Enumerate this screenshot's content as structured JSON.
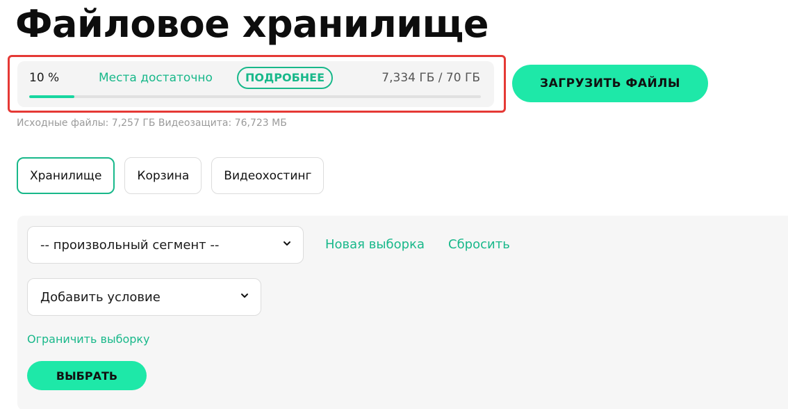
{
  "page": {
    "title": "Файловое хранилище"
  },
  "storage": {
    "percent_label": "10 %",
    "percent_value": 10,
    "status": "Места достаточно",
    "more_label": "ПОДРОБНЕЕ",
    "usage": "7,334 ГБ / 70 ГБ",
    "details": "Исходные файлы: 7,257 ГБ Видеозащита: 76,723 МБ"
  },
  "actions": {
    "upload_label": "ЗАГРУЗИТЬ ФАЙЛЫ"
  },
  "tabs": [
    {
      "label": "Хранилище",
      "active": true
    },
    {
      "label": "Корзина",
      "active": false
    },
    {
      "label": "Видеохостинг",
      "active": false
    }
  ],
  "filter": {
    "segment_value": "-- произвольный сегмент --",
    "new_selection_label": "Новая выборка",
    "reset_label": "Сбросить",
    "condition_value": "Добавить условие",
    "limit_label": "Ограничить выборку",
    "choose_label": "ВЫБРАТЬ"
  },
  "colors": {
    "accent": "#18b88a",
    "button": "#1ee8a8",
    "highlight": "#e53935"
  },
  "icons": {
    "dropdown": "chevron-down-icon"
  }
}
